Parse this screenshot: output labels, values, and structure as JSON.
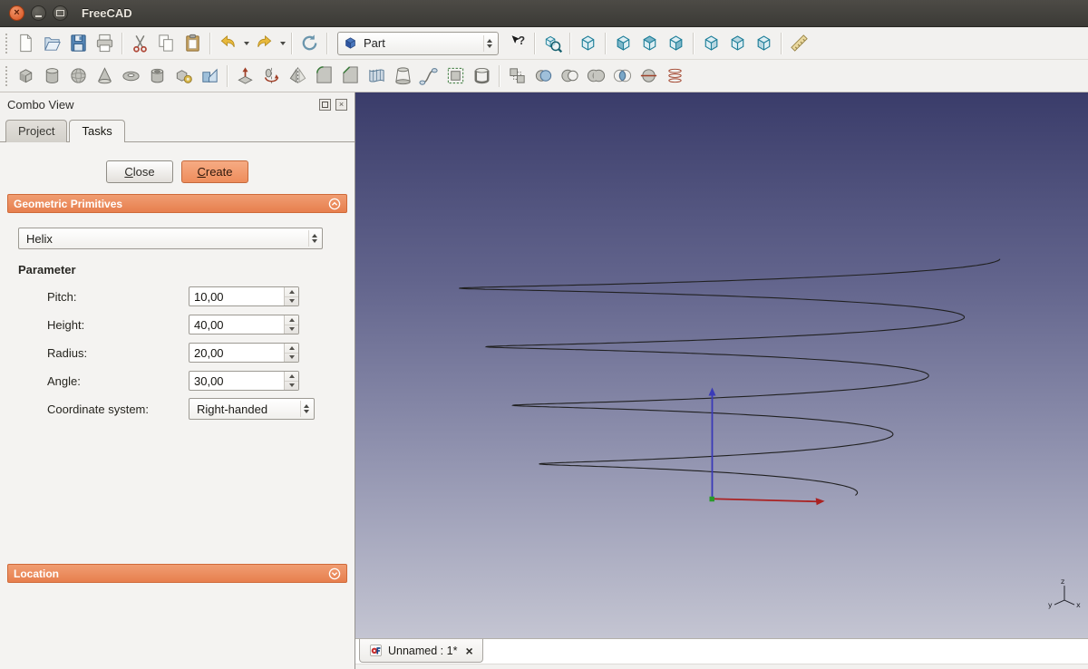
{
  "window": {
    "title": "FreeCAD"
  },
  "toolbar_main": {
    "workbench_selector_value": "Part",
    "items": [
      {
        "icon": "new-document"
      },
      {
        "icon": "open-document"
      },
      {
        "icon": "save-document"
      },
      {
        "icon": "print"
      },
      {
        "sep": true
      },
      {
        "icon": "cut"
      },
      {
        "icon": "copy"
      },
      {
        "icon": "paste"
      },
      {
        "sep": true
      },
      {
        "icon": "undo",
        "dropdown": true
      },
      {
        "icon": "redo",
        "dropdown": true
      },
      {
        "sep": true
      },
      {
        "icon": "refresh"
      },
      {
        "sep": true
      },
      {
        "workbench": true
      },
      {
        "icon": "whats-this"
      },
      {
        "sep": true
      },
      {
        "icon": "fit-all"
      },
      {
        "sep": true
      },
      {
        "icon": "axonometric-view"
      },
      {
        "sep": true
      },
      {
        "icon": "front-view"
      },
      {
        "icon": "top-view"
      },
      {
        "icon": "right-view"
      },
      {
        "sep": true
      },
      {
        "icon": "rear-view"
      },
      {
        "icon": "bottom-view"
      },
      {
        "icon": "left-view"
      },
      {
        "sep": true
      },
      {
        "icon": "measure-distance"
      }
    ]
  },
  "toolbar_part": {
    "items": [
      {
        "icon": "box"
      },
      {
        "icon": "cylinder"
      },
      {
        "icon": "sphere"
      },
      {
        "icon": "cone"
      },
      {
        "icon": "torus"
      },
      {
        "icon": "tube"
      },
      {
        "icon": "create-primitives"
      },
      {
        "icon": "shape-builder"
      },
      {
        "sep": true
      },
      {
        "icon": "extrude"
      },
      {
        "icon": "revolve"
      },
      {
        "icon": "mirror"
      },
      {
        "icon": "fillet"
      },
      {
        "icon": "chamfer"
      },
      {
        "icon": "ruled-surface"
      },
      {
        "icon": "loft"
      },
      {
        "icon": "sweep"
      },
      {
        "icon": "offset"
      },
      {
        "icon": "thickness"
      },
      {
        "sep": true
      },
      {
        "icon": "compound"
      },
      {
        "icon": "boolean"
      },
      {
        "icon": "cut-boolean"
      },
      {
        "icon": "union"
      },
      {
        "icon": "intersection"
      },
      {
        "icon": "section"
      },
      {
        "icon": "cross-sections"
      }
    ]
  },
  "combo_view": {
    "title": "Combo View",
    "tabs": [
      {
        "label": "Project",
        "active": false
      },
      {
        "label": "Tasks",
        "active": true
      }
    ],
    "task_buttons": {
      "close": "Close",
      "create": "Create"
    },
    "sections": [
      {
        "title": "Geometric Primitives",
        "collapsed": false
      },
      {
        "title": "Location",
        "collapsed": true
      }
    ],
    "primitive_selector_value": "Helix",
    "parameter_title": "Parameter",
    "fields": [
      {
        "key": "pitch",
        "label": "Pitch:",
        "value": "10,00",
        "type": "spinbox"
      },
      {
        "key": "height",
        "label": "Height:",
        "value": "40,00",
        "type": "spinbox"
      },
      {
        "key": "radius",
        "label": "Radius:",
        "value": "20,00",
        "type": "spinbox"
      },
      {
        "key": "angle",
        "label": "Angle:",
        "value": "30,00",
        "type": "spinbox"
      },
      {
        "key": "coordinate-system",
        "label": "Coordinate system:",
        "value": "Right-handed",
        "type": "combobox"
      }
    ]
  },
  "viewport": {
    "document_tab_label": "Unnamed : 1*",
    "axis_labels": {
      "x": "x",
      "y": "y",
      "z": "z"
    },
    "colors": {
      "background_top": "#3a3c6a",
      "background_bottom": "#c4c5d2",
      "helix_line": "#202020",
      "x_axis": "#aa2222",
      "z_axis": "#3a3ab8",
      "origin_point": "#2a9a2a"
    }
  }
}
